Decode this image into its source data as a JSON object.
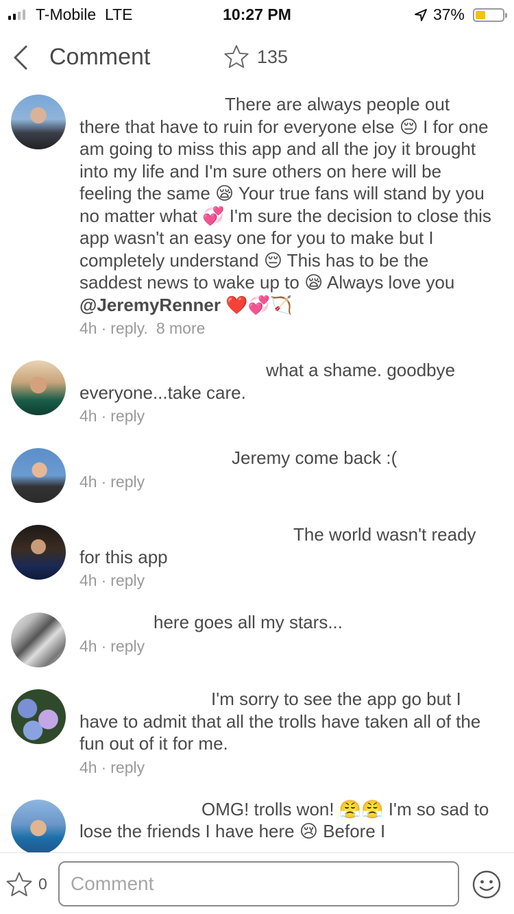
{
  "status_bar": {
    "carrier": "T-Mobile",
    "network": "LTE",
    "time": "10:27 PM",
    "battery_percent": "37%",
    "battery_level": 0.37
  },
  "header": {
    "title": "Comment",
    "star_count": "135"
  },
  "comments": [
    {
      "text_before": "There are always people out there that have to ruin for everyone else 😔 I for one am going to miss this app and all the joy it brought into my life and I'm sure others on here will be feeling the same 😪 Your true fans will stand by you no matter what 💞 I'm sure the decision to close this app wasn't an easy one for you to make but I completely understand 😔 This has to be the saddest news to wake up to 😪 Always love you ",
      "mention": "@JeremyRenner",
      "text_after": " ❤️💞🏹",
      "time": "4h",
      "reply": "reply.",
      "more": "8 more"
    },
    {
      "text": "what a shame. goodbye everyone...take care.",
      "time": "4h",
      "reply": "reply"
    },
    {
      "text": "Jeremy come back :(",
      "time": "4h",
      "reply": "reply"
    },
    {
      "text": "The world wasn't ready for this app",
      "time": "4h",
      "reply": "reply"
    },
    {
      "text": "here goes all my stars...",
      "time": "4h",
      "reply": "reply"
    },
    {
      "text": "I'm sorry to see the app go but I have to admit that all the trolls have taken all of the fun out of it for me.",
      "time": "4h",
      "reply": "reply"
    },
    {
      "text": "OMG! trolls won! 😤😤 I'm so sad to lose the friends I have here 😢 Before I"
    }
  ],
  "bottom_bar": {
    "star_count": "0",
    "input_placeholder": "Comment",
    "input_value": ""
  }
}
